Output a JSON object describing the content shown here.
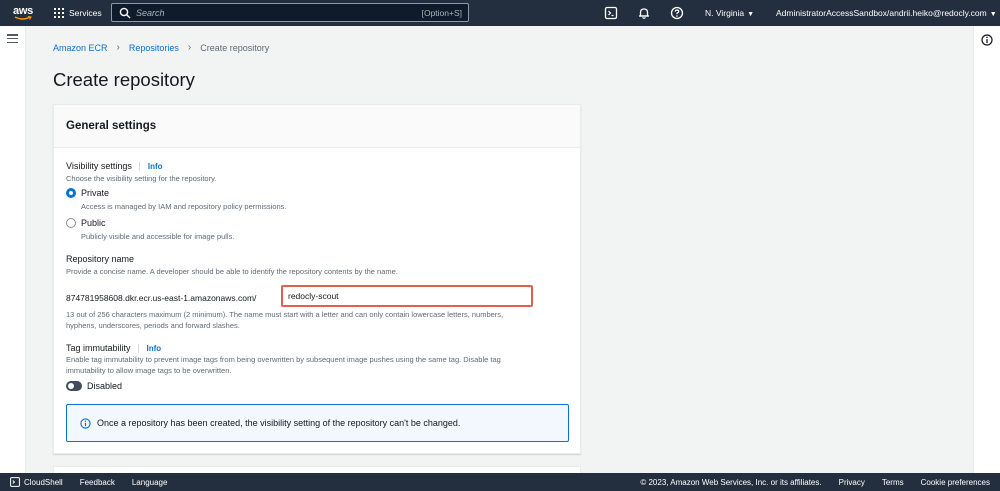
{
  "topnav": {
    "logo_text": "aws",
    "services_label": "Services",
    "search_placeholder": "Search",
    "search_shortcut": "[Option+S]",
    "region": "N. Virginia",
    "account": "AdministratorAccessSandbox/andrii.heiko@redocly.com",
    "icons": [
      "cloudshell-icon",
      "bell-icon",
      "help-icon"
    ]
  },
  "breadcrumb": {
    "items": [
      "Amazon ECR",
      "Repositories"
    ],
    "current": "Create repository"
  },
  "page": {
    "title": "Create repository"
  },
  "general_settings": {
    "title": "General settings",
    "visibility": {
      "label": "Visibility settings",
      "info": "Info",
      "description": "Choose the visibility setting for the repository.",
      "options": [
        {
          "label": "Private",
          "description": "Access is managed by IAM and repository policy permissions.",
          "selected": true
        },
        {
          "label": "Public",
          "description": "Publicly visible and accessible for image pulls.",
          "selected": false
        }
      ]
    },
    "repo_name": {
      "label": "Repository name",
      "description": "Provide a concise name. A developer should be able to identify the repository contents by the name.",
      "prefix": "874781958608.dkr.ecr.us-east-1.amazonaws.com/",
      "value": "redocly-scout",
      "hint_line1": "13 out of 256 characters maximum (2 minimum). The name must start with a letter and can only contain lowercase letters, numbers,",
      "hint_line2": "hyphens, underscores, periods and forward slashes."
    },
    "tag_immutability": {
      "label": "Tag immutability",
      "info": "Info",
      "desc_line1": "Enable tag immutability to prevent image tags from being overwritten by subsequent image pushes using the same tag. Disable tag",
      "desc_line2": "immutability to allow image tags to be overwritten.",
      "toggle_label": "Disabled",
      "enabled": false
    },
    "alert": "Once a repository has been created, the visibility setting of the repository can't be changed."
  },
  "footer": {
    "cloudshell": "CloudShell",
    "feedback": "Feedback",
    "language": "Language",
    "copyright": "© 2023, Amazon Web Services, Inc. or its affiliates.",
    "privacy": "Privacy",
    "terms": "Terms",
    "cookies": "Cookie preferences"
  },
  "colors": {
    "nav_bg": "#232f3e",
    "link": "#0972d3",
    "highlight_border": "#e0614e"
  }
}
